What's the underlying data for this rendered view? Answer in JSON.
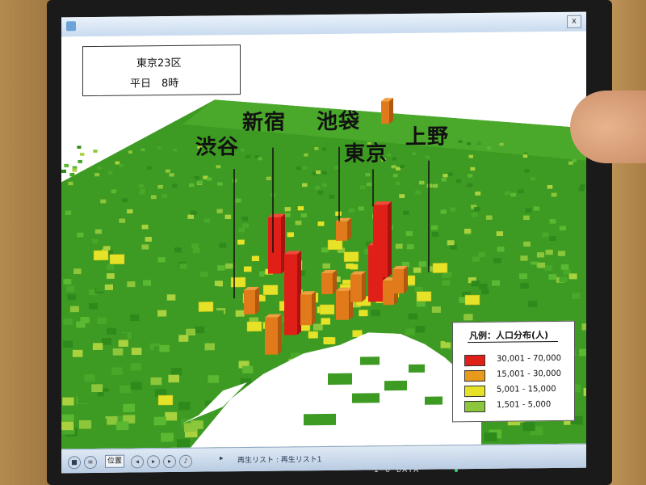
{
  "window": {
    "close_label": "x"
  },
  "info_box": {
    "line1": "東京23区",
    "line2": "平日　8時"
  },
  "districts": [
    {
      "name": "渋谷"
    },
    {
      "name": "新宿"
    },
    {
      "name": "池袋"
    },
    {
      "name": "東京"
    },
    {
      "name": "上野"
    }
  ],
  "legend": {
    "title": "凡例：人口分布(人)",
    "items": [
      {
        "label": "30,001 - 70,000",
        "color": "#e02018"
      },
      {
        "label": "15,001 - 30,000",
        "color": "#e89a1c"
      },
      {
        "label": "5,001 - 15,000",
        "color": "#e5e227"
      },
      {
        "label": "1,501 - 5,000",
        "color": "#8cc63a"
      }
    ]
  },
  "player": {
    "pos_label": "位置",
    "playlist_text": "再生リスト : 再生リスト1",
    "playlist_arrow": "▸"
  },
  "monitor": {
    "brand": "I-O DATA"
  },
  "colors": {
    "ground_green": "#3d9a22",
    "ground_dark_green": "#2f7a18",
    "water": "#ffffff"
  }
}
